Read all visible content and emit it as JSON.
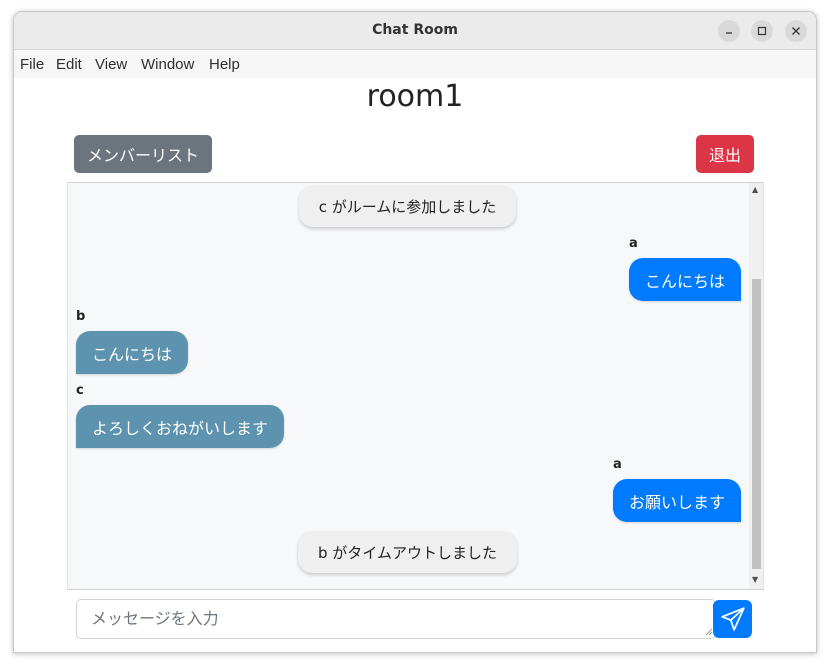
{
  "window": {
    "title": "Chat Room"
  },
  "menu": [
    "File",
    "Edit",
    "View",
    "Window",
    "Help"
  ],
  "room": {
    "name": "room1"
  },
  "buttons": {
    "members": "メンバーリスト",
    "exit": "退出"
  },
  "messages": [
    {
      "type": "system",
      "text": "c がルームに参加しました"
    },
    {
      "type": "mine",
      "sender": "a",
      "text": "こんにちは"
    },
    {
      "type": "other",
      "sender": "b",
      "text": "こんにちは"
    },
    {
      "type": "other",
      "sender": "c",
      "text": "よろしくおねがいします"
    },
    {
      "type": "mine",
      "sender": "a",
      "text": "お願いします"
    },
    {
      "type": "system",
      "text": "b がタイムアウトしました"
    }
  ],
  "composer": {
    "placeholder": "メッセージを入力",
    "value": "",
    "send_icon": "paper-plane-icon"
  },
  "colors": {
    "mine": "#007bff",
    "other": "#5d93ae",
    "members_button": "#6c757d",
    "exit_button": "#dc3545"
  }
}
